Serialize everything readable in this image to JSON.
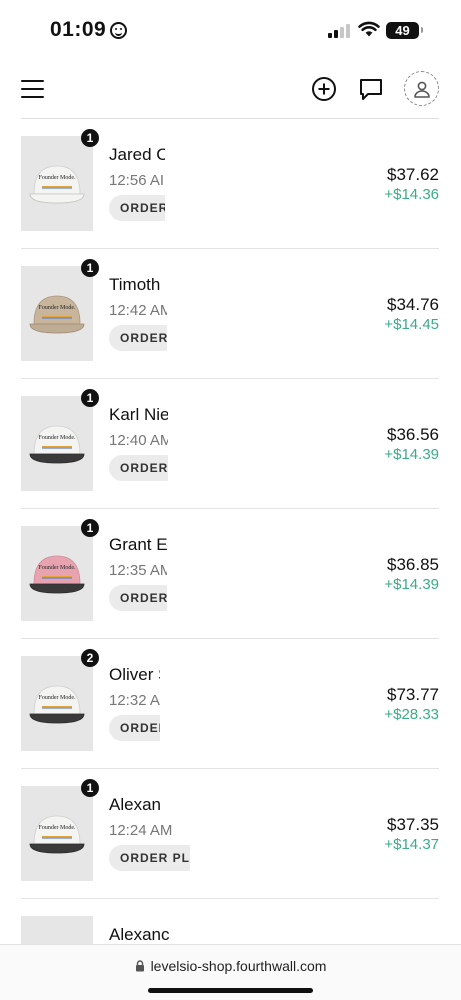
{
  "status_bar": {
    "time": "01:09",
    "battery": "49"
  },
  "nav": {
    "menu_icon": "hamburger-icon",
    "add_icon": "plus-circle-icon",
    "messages_icon": "chat-bubble-icon",
    "account_icon": "user-icon"
  },
  "orders": [
    {
      "name": "Jared C",
      "time": "12:56 AI",
      "status": "ORDER",
      "total": "$37.62",
      "profit": "+$14.36",
      "qty": "1",
      "cap_color": "white"
    },
    {
      "name": "Timoth",
      "time": "12:42 AM",
      "status": "ORDER",
      "total": "$34.76",
      "profit": "+$14.45",
      "qty": "1",
      "cap_color": "khaki"
    },
    {
      "name": "Karl Nie",
      "time": "12:40 AM",
      "status": "ORDER",
      "total": "$36.56",
      "profit": "+$14.39",
      "qty": "1",
      "cap_color": "white"
    },
    {
      "name": "Grant E",
      "time": "12:35 AM",
      "status": "ORDER",
      "total": "$36.85",
      "profit": "+$14.39",
      "qty": "1",
      "cap_color": "pink"
    },
    {
      "name": "Oliver S",
      "time": "12:32 A",
      "status": "ORDEI",
      "total": "$73.77",
      "profit": "+$28.33",
      "qty": "2",
      "cap_color": "white"
    },
    {
      "name": "Alexan",
      "time": "12:24 AM",
      "status": "ORDER PL",
      "total": "$37.35",
      "profit": "+$14.37",
      "qty": "1",
      "cap_color": "white"
    },
    {
      "name": "Alexanc",
      "time": "",
      "status": "",
      "total": "",
      "profit": "",
      "qty": "",
      "cap_color": "pink"
    }
  ],
  "cap_text": "Founder Mode.",
  "colors": {
    "profit": "#3cab86",
    "cap_white": "#f4f4f2",
    "cap_khaki": "#c9b59c",
    "cap_pink": "#e8a3b0"
  },
  "url_bar": {
    "url": "levelsio-shop.fourthwall.com"
  }
}
